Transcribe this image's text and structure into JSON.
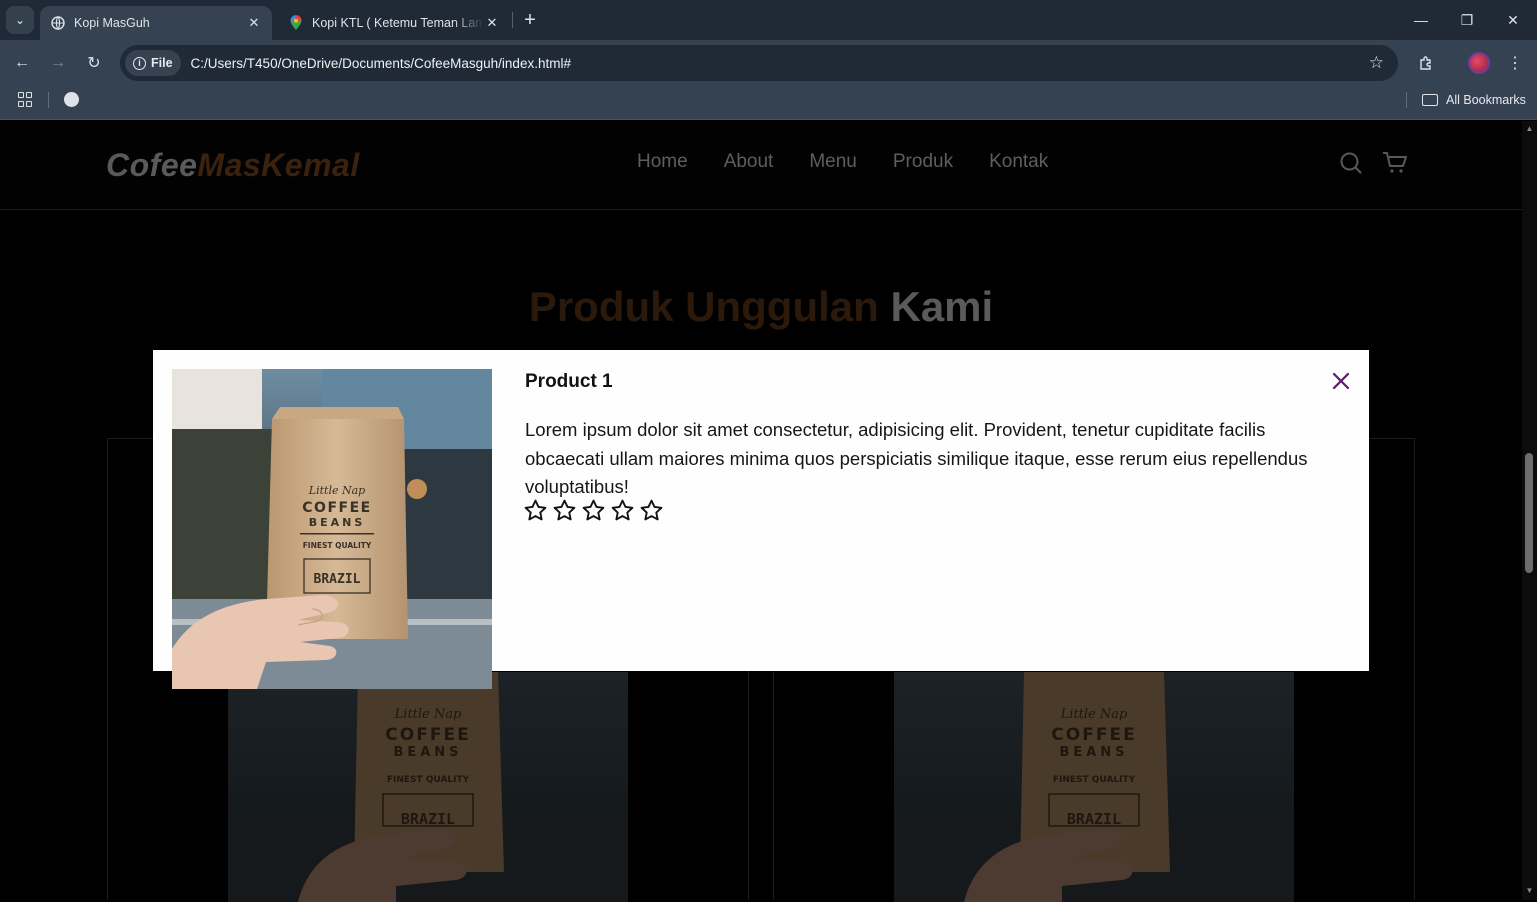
{
  "browser": {
    "tabs": [
      {
        "title": "Kopi MasGuh",
        "active": true
      },
      {
        "title": "Kopi KTL ( Ketemu Teman Lama )",
        "active": false
      }
    ],
    "file_chip": "File",
    "url": "C:/Users/T450/OneDrive/Documents/CofeeMasguh/index.html#",
    "all_bookmarks": "All Bookmarks"
  },
  "site": {
    "logo_part1": "Cofee",
    "logo_part2": "MasKemal",
    "menu": [
      "Home",
      "About",
      "Menu",
      "Produk",
      "Kontak"
    ],
    "section_title_part1": "Produk Unggulan",
    "section_title_part2": "Kami",
    "colors": {
      "brand_brown": "#b6763f",
      "modal_close": "#5b1d6d"
    }
  },
  "modal": {
    "title": "Product 1",
    "description": "Lorem ipsum dolor sit amet consectetur, adipisicing elit. Provident, tenetur cupiditate facilis obcaecati ullam maiores minima quos perspiciatis similique itaque, esse rerum eius repellendus voluptatibus!",
    "rating": 0,
    "rating_max": 5,
    "product_image": {
      "brand": "Little Nap",
      "line1": "COFFEE",
      "line2": "BEANS",
      "quality": "FINEST QUALITY",
      "origin": "BRAZIL"
    }
  }
}
